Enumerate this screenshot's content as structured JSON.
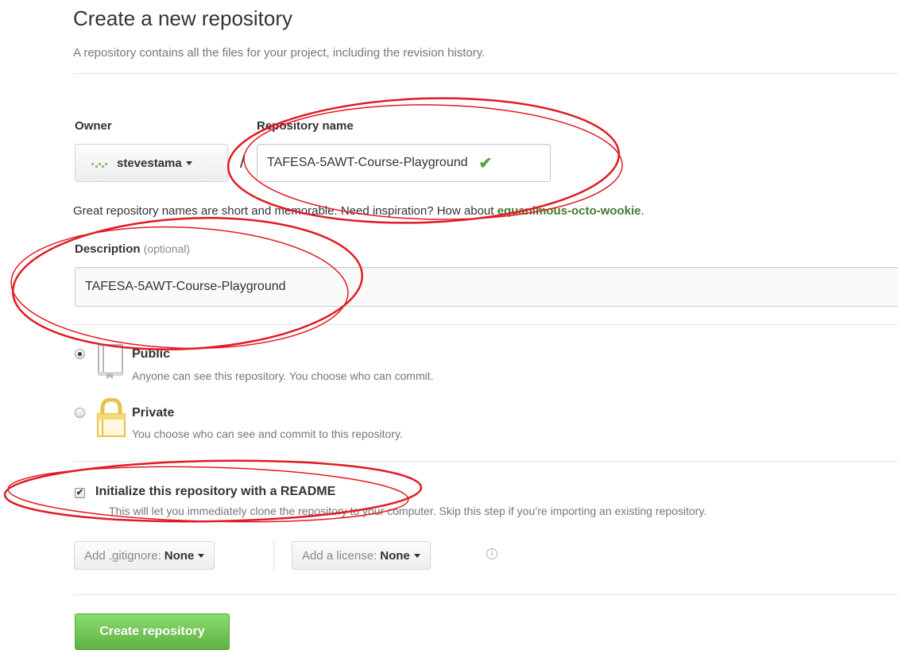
{
  "header": {
    "title": "Create a new repository",
    "subtitle": "A repository contains all the files for your project, including the revision history."
  },
  "owner": {
    "label": "Owner",
    "name": "stevestama"
  },
  "repository": {
    "label": "Repository name",
    "separator": "/",
    "value": "TAFESA-5AWT-Course-Playground"
  },
  "hint": {
    "text": "Great repository names are short and memorable. Need inspiration? How about ",
    "suggestion": "equanimous-octo-wookie",
    "end": "."
  },
  "description": {
    "label": "Description",
    "optional": "(optional)",
    "value": "TAFESA-5AWT-Course-Playground"
  },
  "visibility": {
    "public": {
      "title": "Public",
      "desc": "Anyone can see this repository. You choose who can commit.",
      "selected": true
    },
    "private": {
      "title": "Private",
      "desc": "You choose who can see and commit to this repository.",
      "selected": false
    }
  },
  "readme": {
    "checked": true,
    "title": "Initialize this repository with a README",
    "desc": "This will let you immediately clone the repository to your computer. Skip this step if you’re importing an existing repository."
  },
  "gitignore": {
    "label": "Add .gitignore:",
    "value": "None"
  },
  "license": {
    "label": "Add a license:",
    "value": "None"
  },
  "create_button": "Create repository",
  "colors": {
    "annotation": "#e01b24",
    "primary_button": "#60b044",
    "check": "#55a532",
    "suggestion": "#457a2f"
  }
}
